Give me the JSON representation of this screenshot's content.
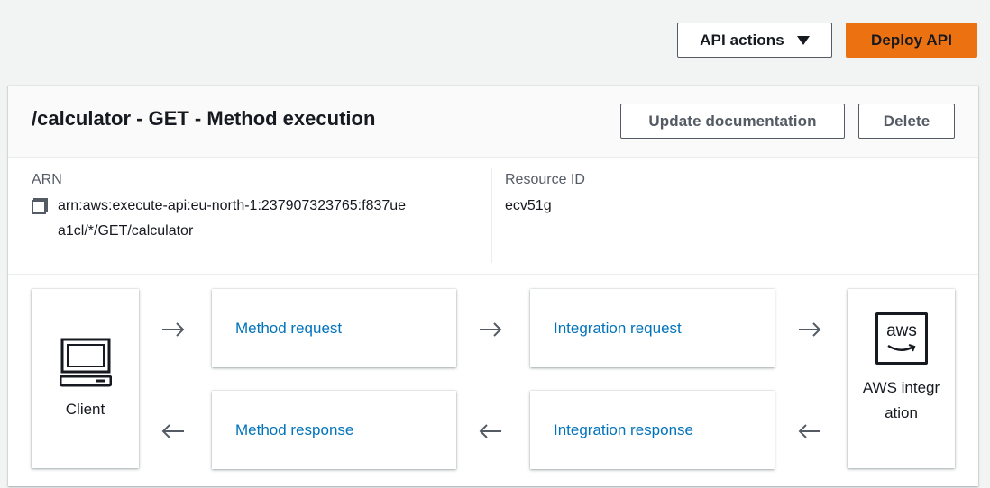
{
  "toolbar": {
    "api_actions_label": "API actions",
    "deploy_label": "Deploy API"
  },
  "panel": {
    "title": "/calculator - GET - Method execution",
    "update_doc_label": "Update documentation",
    "delete_label": "Delete"
  },
  "info": {
    "arn_label": "ARN",
    "arn_value": "arn:aws:execute-api:eu-north-1:237907323765:f837uea1cl/*/GET/calculator",
    "resource_id_label": "Resource ID",
    "resource_id_value": "ecv51g"
  },
  "flow": {
    "client_label": "Client",
    "method_request": "Method request",
    "integration_request": "Integration request",
    "method_response": "Method response",
    "integration_response": "Integration response",
    "aws_logo_text": "aws",
    "aws_label": "AWS integration"
  },
  "icons": {
    "caret": "caret-down-icon",
    "copy": "copy-icon",
    "client": "laptop-icon",
    "aws": "aws-logo-icon",
    "arrow_right": "arrow-right-icon",
    "arrow_left": "arrow-left-icon"
  },
  "colors": {
    "primary": "#ec7211",
    "link": "#0073bb",
    "background": "#f2f3f3"
  }
}
